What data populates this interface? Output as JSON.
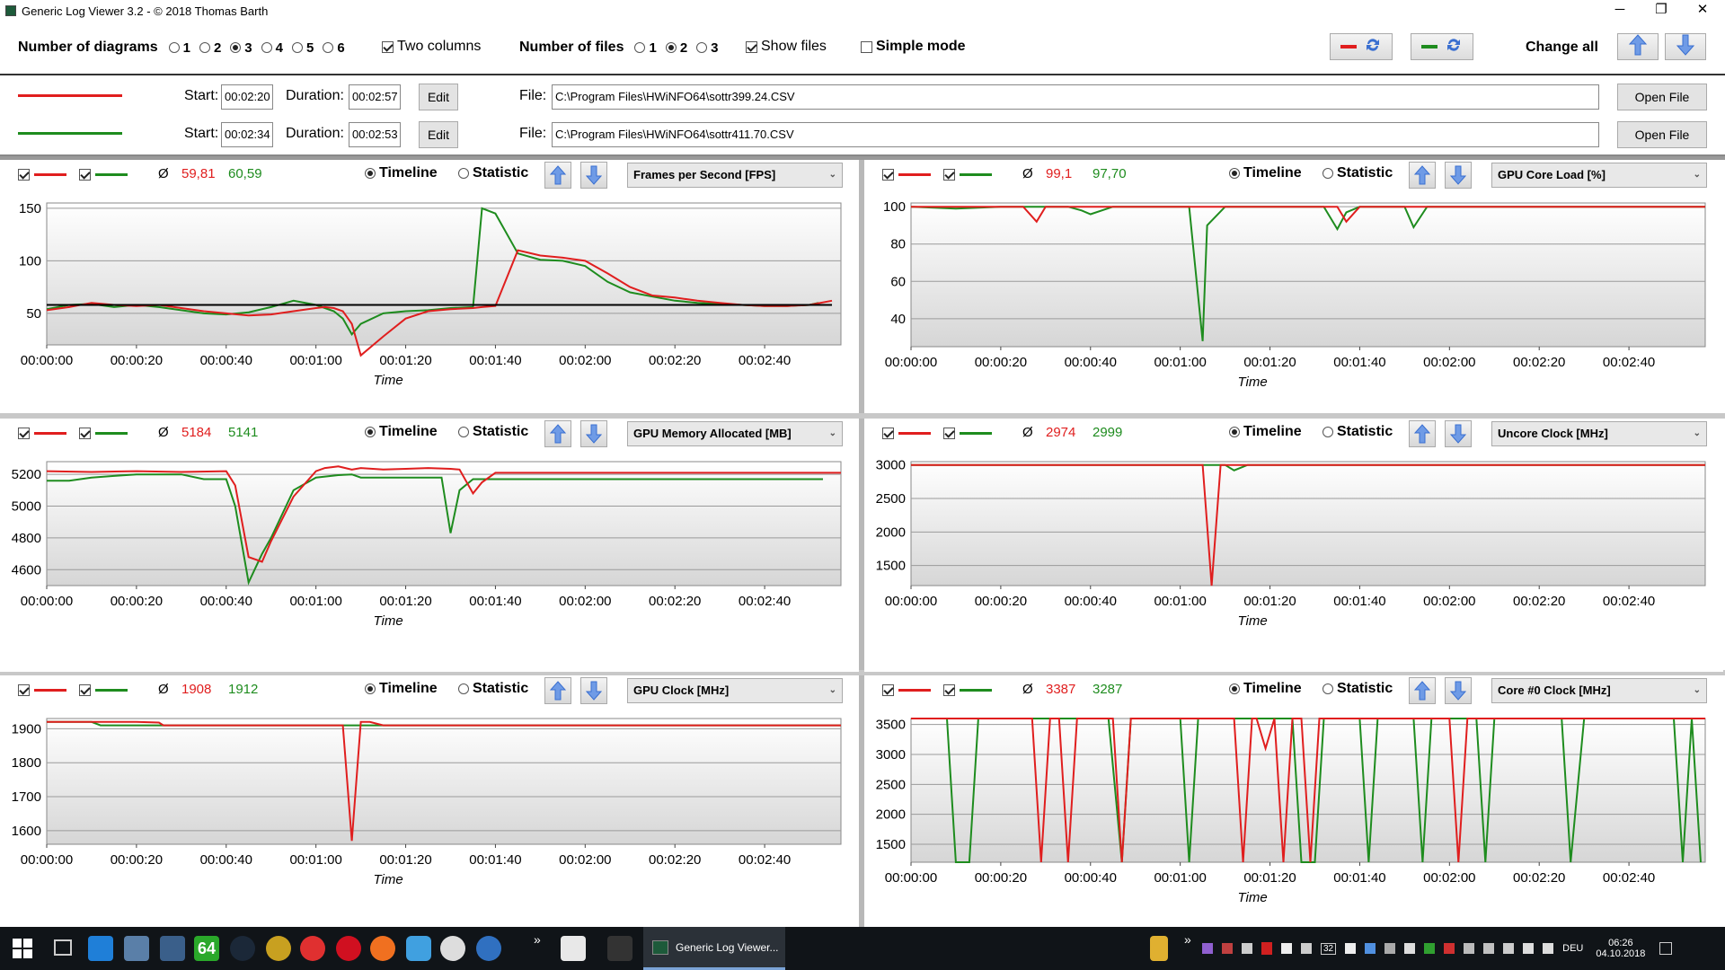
{
  "window": {
    "title": "Generic Log Viewer 3.2 - © 2018 Thomas Barth",
    "minimize": "─",
    "restore": "❐",
    "close": "✕"
  },
  "toolbar": {
    "diagrams_label": "Number of diagrams",
    "diagram_options": [
      "1",
      "2",
      "3",
      "4",
      "5",
      "6"
    ],
    "diagram_selected": "3",
    "two_columns_label": "Two columns",
    "files_label": "Number of files",
    "file_options": [
      "1",
      "2",
      "3"
    ],
    "file_selected": "2",
    "show_files_label": "Show files",
    "simple_mode_label": "Simple mode",
    "change_all_label": "Change all"
  },
  "colors": {
    "file1": "#e01e1e",
    "file2": "#1e8c1e",
    "accent": "#4a7fd4"
  },
  "files": [
    {
      "start_label": "Start:",
      "start": "00:02:20",
      "duration_label": "Duration:",
      "duration": "00:02:57",
      "edit": "Edit",
      "file_label": "File:",
      "path": "C:\\Program Files\\HWiNFO64\\sottr399.24.CSV",
      "open": "Open File"
    },
    {
      "start_label": "Start:",
      "start": "00:02:34",
      "duration_label": "Duration:",
      "duration": "00:02:53",
      "edit": "Edit",
      "file_label": "File:",
      "path": "C:\\Program Files\\HWiNFO64\\sottr411.70.CSV",
      "open": "Open File"
    }
  ],
  "panel_common": {
    "avg_symbol": "Ø",
    "timeline": "Timeline",
    "statistic": "Statistic",
    "xlabel": "Time",
    "xticks": [
      "00:00:00",
      "00:00:20",
      "00:00:40",
      "00:01:00",
      "00:01:20",
      "00:01:40",
      "00:02:00",
      "00:02:20",
      "00:02:40"
    ]
  },
  "panels": [
    {
      "metric": "Frames per Second [FPS]",
      "avg1": "59,81",
      "avg2": "60,59"
    },
    {
      "metric": "GPU Core Load [%]",
      "avg1": "99,1",
      "avg2": "97,70"
    },
    {
      "metric": "GPU Memory Allocated [MB]",
      "avg1": "5184",
      "avg2": "5141"
    },
    {
      "metric": "Uncore Clock [MHz]",
      "avg1": "2974",
      "avg2": "2999"
    },
    {
      "metric": "GPU Clock [MHz]",
      "avg1": "1908",
      "avg2": "1912"
    },
    {
      "metric": "Core #0 Clock [MHz]",
      "avg1": "3387",
      "avg2": "3287"
    }
  ],
  "chart_data": [
    {
      "type": "line",
      "ylim": [
        20,
        155
      ],
      "yticks": [
        "150",
        "100",
        "50"
      ],
      "yvals": [
        150,
        100,
        50
      ],
      "xlim": [
        0,
        177
      ],
      "hline": 58,
      "series": [
        {
          "x": [
            0,
            5,
            10,
            15,
            20,
            25,
            30,
            35,
            40,
            45,
            50,
            55,
            60,
            62,
            64,
            66,
            68,
            70,
            75,
            80,
            85,
            90,
            95,
            97,
            100,
            105,
            110,
            115,
            120,
            125,
            130,
            135,
            140,
            145,
            150,
            155,
            160,
            165,
            170,
            175
          ],
          "values": [
            53,
            56,
            60,
            58,
            57,
            58,
            55,
            52,
            50,
            48,
            49,
            52,
            55,
            56,
            55,
            52,
            40,
            10,
            28,
            45,
            52,
            54,
            55,
            56,
            57,
            110,
            105,
            103,
            100,
            88,
            75,
            67,
            65,
            62,
            60,
            58,
            57,
            57,
            58,
            62
          ]
        },
        {
          "x": [
            0,
            5,
            10,
            15,
            20,
            25,
            30,
            35,
            40,
            45,
            50,
            55,
            60,
            62,
            64,
            66,
            68,
            70,
            75,
            80,
            85,
            90,
            95,
            97,
            100,
            105,
            110,
            115,
            120,
            125,
            130,
            135,
            140,
            145,
            150,
            155,
            160,
            165,
            170,
            172
          ],
          "values": [
            54,
            58,
            59,
            56,
            58,
            56,
            53,
            50,
            49,
            51,
            56,
            62,
            58,
            55,
            52,
            45,
            30,
            40,
            50,
            52,
            53,
            55,
            56,
            150,
            145,
            107,
            101,
            100,
            95,
            80,
            70,
            66,
            62,
            60,
            59,
            58,
            57,
            57,
            58,
            60
          ]
        }
      ]
    },
    {
      "type": "line",
      "ylim": [
        25,
        102
      ],
      "yticks": [
        "100",
        "80",
        "60",
        "40"
      ],
      "yvals": [
        100,
        80,
        60,
        40
      ],
      "xlim": [
        0,
        177
      ],
      "series": [
        {
          "x": [
            0,
            10,
            20,
            25,
            28,
            30,
            35,
            40,
            45,
            50,
            55,
            60,
            65,
            70,
            75,
            80,
            85,
            90,
            95,
            97,
            100,
            110,
            120,
            130,
            140,
            150,
            160,
            170,
            177
          ],
          "values": [
            100,
            100,
            100,
            100,
            92,
            100,
            100,
            100,
            100,
            100,
            100,
            100,
            100,
            100,
            100,
            100,
            100,
            100,
            100,
            92,
            100,
            100,
            100,
            100,
            100,
            100,
            100,
            100,
            100
          ]
        },
        {
          "x": [
            0,
            10,
            20,
            30,
            35,
            38,
            40,
            45,
            60,
            62,
            65,
            66,
            70,
            80,
            90,
            92,
            95,
            97,
            100,
            110,
            112,
            115,
            120,
            130,
            140,
            150,
            160,
            170,
            177
          ],
          "values": [
            100,
            99,
            100,
            100,
            100,
            98,
            96,
            100,
            100,
            100,
            28,
            90,
            100,
            100,
            100,
            100,
            88,
            97,
            100,
            100,
            89,
            100,
            100,
            100,
            100,
            100,
            100,
            100,
            100
          ]
        }
      ]
    },
    {
      "type": "line",
      "ylim": [
        4500,
        5280
      ],
      "yticks": [
        "5200",
        "5000",
        "4800",
        "4600"
      ],
      "yvals": [
        5200,
        5000,
        4800,
        4600
      ],
      "xlim": [
        0,
        177
      ],
      "series": [
        {
          "x": [
            0,
            10,
            20,
            30,
            40,
            42,
            45,
            48,
            50,
            55,
            60,
            62,
            65,
            68,
            70,
            75,
            80,
            85,
            90,
            92,
            95,
            97,
            100,
            110,
            120,
            130,
            140,
            150,
            160,
            170,
            177
          ],
          "values": [
            5220,
            5215,
            5220,
            5215,
            5220,
            5130,
            4680,
            4650,
            4780,
            5060,
            5220,
            5240,
            5250,
            5230,
            5240,
            5230,
            5235,
            5240,
            5235,
            5230,
            5080,
            5150,
            5210,
            5210,
            5210,
            5210,
            5210,
            5210,
            5210,
            5210,
            5210
          ]
        },
        {
          "x": [
            0,
            5,
            10,
            15,
            20,
            30,
            35,
            40,
            42,
            45,
            48,
            50,
            55,
            60,
            65,
            68,
            70,
            75,
            80,
            85,
            88,
            90,
            92,
            95,
            100,
            110,
            120,
            130,
            140,
            150,
            160,
            170,
            173
          ],
          "values": [
            5160,
            5160,
            5180,
            5190,
            5200,
            5200,
            5170,
            5170,
            5000,
            4520,
            4700,
            4800,
            5100,
            5180,
            5195,
            5200,
            5180,
            5180,
            5180,
            5180,
            5180,
            4830,
            5100,
            5170,
            5170,
            5170,
            5170,
            5170,
            5170,
            5170,
            5170,
            5170,
            5170
          ]
        }
      ]
    },
    {
      "type": "line",
      "ylim": [
        1200,
        3050
      ],
      "yticks": [
        "3000",
        "2500",
        "2000",
        "1500"
      ],
      "yvals": [
        3000,
        2500,
        2000,
        1500
      ],
      "xlim": [
        0,
        177
      ],
      "series": [
        {
          "x": [
            0,
            30,
            60,
            65,
            67,
            69,
            71,
            100,
            140,
            177
          ],
          "values": [
            3000,
            3000,
            3000,
            3000,
            1200,
            3000,
            3000,
            3000,
            3000,
            3000
          ]
        },
        {
          "x": [
            0,
            30,
            60,
            68,
            70,
            72,
            75,
            100,
            140,
            177
          ],
          "values": [
            3000,
            3000,
            3000,
            3000,
            3000,
            2920,
            3000,
            3000,
            3000,
            3000
          ]
        }
      ]
    },
    {
      "type": "line",
      "ylim": [
        1560,
        1930
      ],
      "yticks": [
        "1900",
        "1800",
        "1700",
        "1600"
      ],
      "yvals": [
        1900,
        1800,
        1700,
        1600
      ],
      "xlim": [
        0,
        177
      ],
      "series": [
        {
          "x": [
            0,
            10,
            20,
            25,
            26,
            65,
            66,
            68,
            70,
            72,
            75,
            100,
            140,
            177
          ],
          "values": [
            1920,
            1920,
            1920,
            1918,
            1910,
            1910,
            1910,
            1570,
            1920,
            1920,
            1910,
            1910,
            1910,
            1910
          ]
        },
        {
          "x": [
            0,
            10,
            12,
            20,
            30,
            60,
            100,
            140,
            177
          ],
          "values": [
            1920,
            1920,
            1910,
            1910,
            1910,
            1910,
            1910,
            1910,
            1910
          ]
        }
      ]
    },
    {
      "type": "line",
      "ylim": [
        1200,
        3600
      ],
      "yticks": [
        "3500",
        "3000",
        "2500",
        "2000",
        "1500"
      ],
      "yvals": [
        3500,
        3000,
        2500,
        2000,
        1500
      ],
      "xlim": [
        0,
        177
      ],
      "series": [
        {
          "x": [
            0,
            27,
            29,
            31,
            33,
            35,
            37,
            45,
            47,
            49,
            72,
            74,
            76,
            77,
            79,
            81,
            83,
            85,
            86,
            87,
            89,
            91,
            120,
            122,
            124,
            150,
            177
          ],
          "values": [
            3600,
            3600,
            1200,
            3600,
            3600,
            1200,
            3600,
            3600,
            1200,
            3600,
            3600,
            1200,
            3600,
            3600,
            3100,
            3600,
            1200,
            3600,
            3600,
            3600,
            1200,
            3600,
            3600,
            1200,
            3600,
            3600,
            3600
          ]
        },
        {
          "x": [
            0,
            8,
            10,
            13,
            15,
            40,
            42,
            44,
            47,
            49,
            60,
            62,
            64,
            85,
            87,
            90,
            92,
            94,
            100,
            102,
            104,
            112,
            114,
            116,
            118,
            120,
            126,
            128,
            130,
            140,
            145,
            147,
            150,
            170,
            172,
            174,
            176
          ],
          "values": [
            3600,
            3600,
            1200,
            1200,
            3600,
            3600,
            3600,
            3600,
            1200,
            3600,
            3600,
            1200,
            3600,
            3600,
            1200,
            1200,
            3600,
            3600,
            3600,
            1200,
            3600,
            3600,
            1200,
            3600,
            3600,
            3600,
            3600,
            1200,
            3600,
            3600,
            3600,
            1200,
            3600,
            3600,
            1200,
            3600,
            1200
          ]
        }
      ]
    }
  ],
  "taskbar": {
    "active_app": "Generic Log Viewer...",
    "lang": "DEU",
    "time": "06:26",
    "date": "04.10.2018",
    "tray_num": "32",
    "badge_64": "64"
  }
}
